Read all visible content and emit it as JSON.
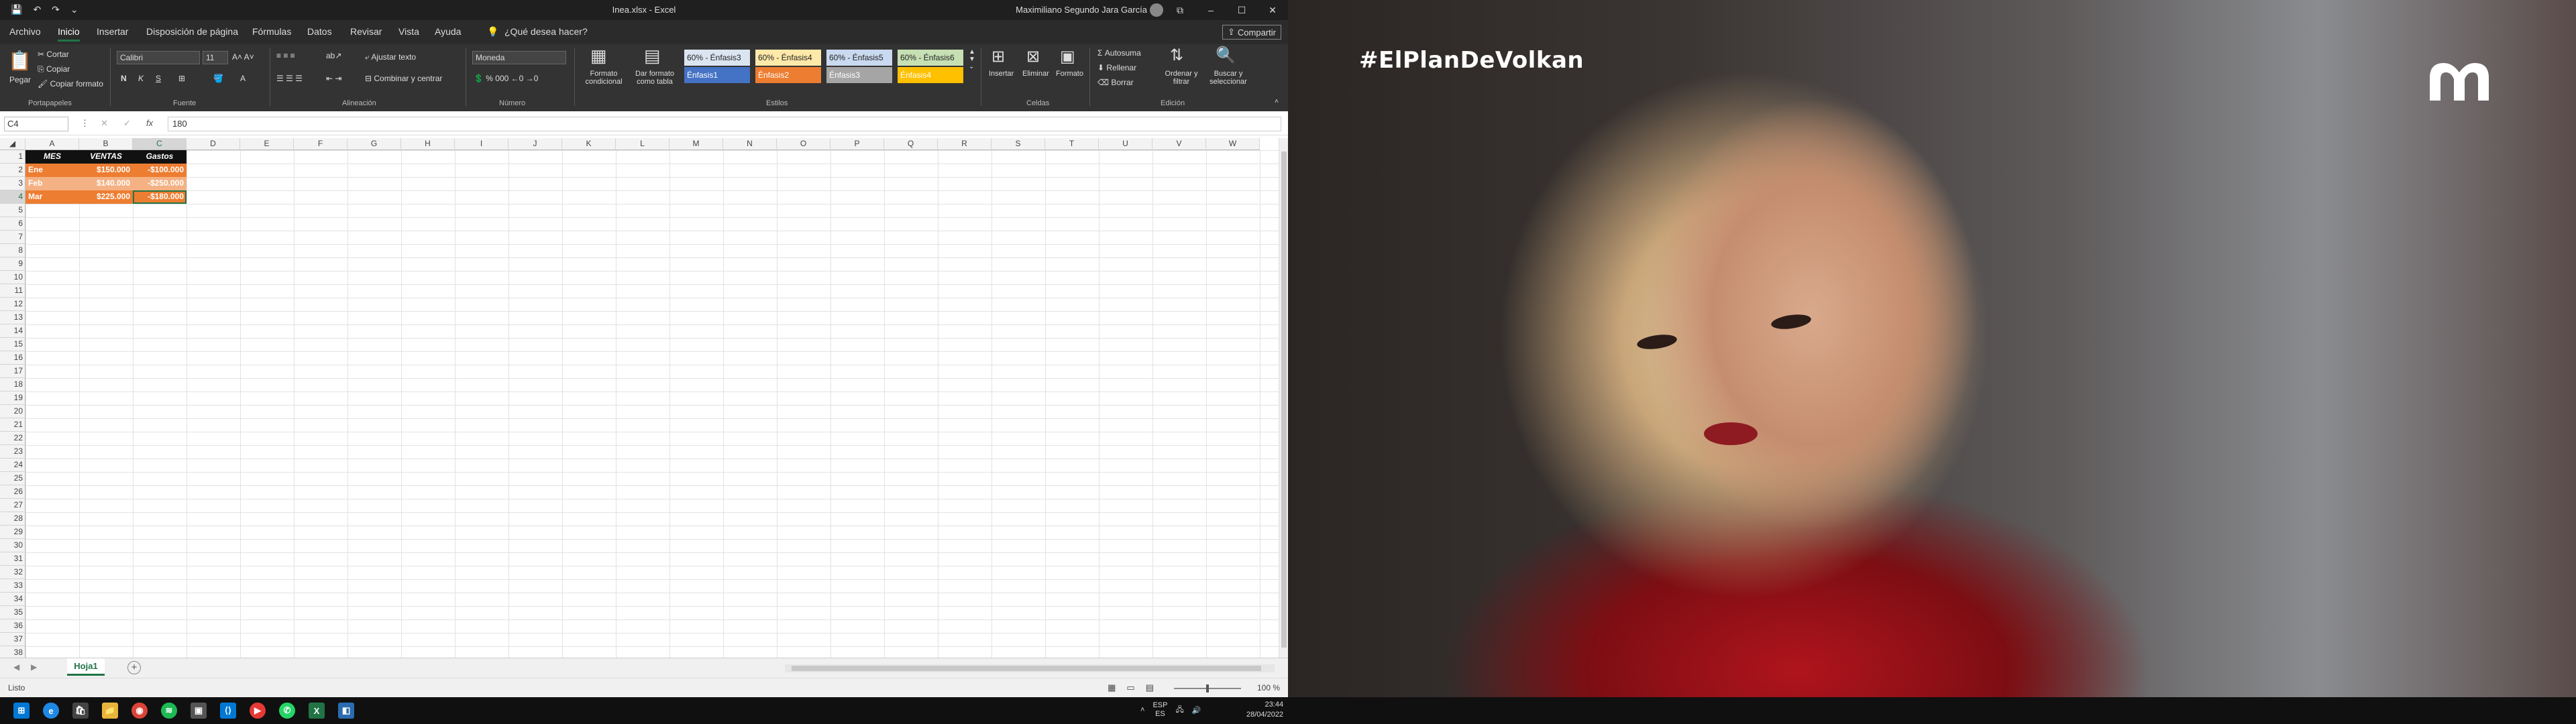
{
  "window": {
    "document_title": "Inea.xlsx - Excel",
    "user_name": "Maximiliano Segundo Jara García",
    "controls": {
      "ribbon_display": "⧉",
      "minimize": "–",
      "maximize": "☐",
      "close": "✕"
    }
  },
  "qat": {
    "save": "💾",
    "undo": "↶",
    "redo": "↷",
    "customize": "⌄"
  },
  "menu": {
    "tabs": [
      {
        "label": "Archivo"
      },
      {
        "label": "Inicio"
      },
      {
        "label": "Insertar"
      },
      {
        "label": "Disposición de página"
      },
      {
        "label": "Fórmulas"
      },
      {
        "label": "Datos"
      },
      {
        "label": "Revisar"
      },
      {
        "label": "Vista"
      },
      {
        "label": "Ayuda"
      },
      {
        "label": "¿Qué desea hacer?"
      }
    ],
    "share_label": "Compartir"
  },
  "ribbon": {
    "clipboard": {
      "paste": "Pegar",
      "cut": "Cortar",
      "copy": "Copiar",
      "format_painter": "Copiar formato",
      "label": "Portapapeles"
    },
    "font": {
      "name": "Calibri",
      "size": "11",
      "bold": "N",
      "italic": "K",
      "underline": "S",
      "label": "Fuente"
    },
    "alignment": {
      "wrap": "Ajustar texto",
      "merge": "Combinar y centrar",
      "label": "Alineación"
    },
    "number": {
      "format": "Moneda",
      "label": "Número"
    },
    "styles": {
      "conditional": "Formato condicional",
      "as_table": "Dar formato como tabla",
      "cells": [
        {
          "label": "60% - Énfasis3",
          "bg": "#dbe5f1",
          "fg": "#222"
        },
        {
          "label": "60% - Énfasis4",
          "bg": "#fde9a8",
          "fg": "#222"
        },
        {
          "label": "60% - Énfasis5",
          "bg": "#c9d9ef",
          "fg": "#222"
        },
        {
          "label": "60% - Énfasis6",
          "bg": "#c6e0b4",
          "fg": "#222"
        },
        {
          "label": "Énfasis1",
          "bg": "#4472c4",
          "fg": "#fff"
        },
        {
          "label": "Énfasis2",
          "bg": "#ed7d31",
          "fg": "#fff"
        },
        {
          "label": "Énfasis3",
          "bg": "#a5a5a5",
          "fg": "#fff"
        },
        {
          "label": "Énfasis4",
          "bg": "#ffc000",
          "fg": "#fff"
        }
      ],
      "label": "Estilos"
    },
    "cells": {
      "insert": "Insertar",
      "delete": "Eliminar",
      "format": "Formato",
      "label": "Celdas"
    },
    "editing": {
      "autosum": "Autosuma",
      "fill": "Rellenar",
      "clear": "Borrar",
      "sort": "Ordenar y filtrar",
      "find": "Buscar y seleccionar",
      "label": "Edición"
    }
  },
  "formula_bar": {
    "name_box": "C4",
    "fx": "fx",
    "value": "180"
  },
  "grid": {
    "columns": [
      "A",
      "B",
      "C",
      "D",
      "E",
      "F",
      "G",
      "H",
      "I",
      "J",
      "K",
      "L",
      "M",
      "N",
      "O",
      "P",
      "Q",
      "R",
      "S",
      "T",
      "U",
      "V",
      "W"
    ],
    "rows": [
      "1",
      "2",
      "3",
      "4",
      "5",
      "6",
      "7",
      "8",
      "9",
      "10",
      "11",
      "12",
      "13",
      "14",
      "15",
      "16",
      "17",
      "18",
      "19",
      "20",
      "21",
      "22",
      "23",
      "24",
      "25",
      "26",
      "27",
      "28",
      "29",
      "30",
      "31",
      "32",
      "33",
      "34",
      "35",
      "36",
      "37",
      "38"
    ],
    "table": {
      "headers": [
        "MES",
        "VENTAS",
        "Gastos"
      ],
      "rows": [
        [
          "Ene",
          "$150.000",
          "-$100.000"
        ],
        [
          "Feb",
          "$140.000",
          "-$250.000"
        ],
        [
          "Mar",
          "$225.000",
          "-$180.000"
        ]
      ]
    }
  },
  "sheets": {
    "active": "Hoja1",
    "add": "+"
  },
  "status": {
    "ready": "Listo",
    "zoom": "100 %"
  },
  "video": {
    "hashtag": "#ElPlanDeVolkan"
  },
  "taskbar": {
    "language": "ESP",
    "language_sub": "ES",
    "time": "23:44",
    "date": "28/04/2022"
  }
}
